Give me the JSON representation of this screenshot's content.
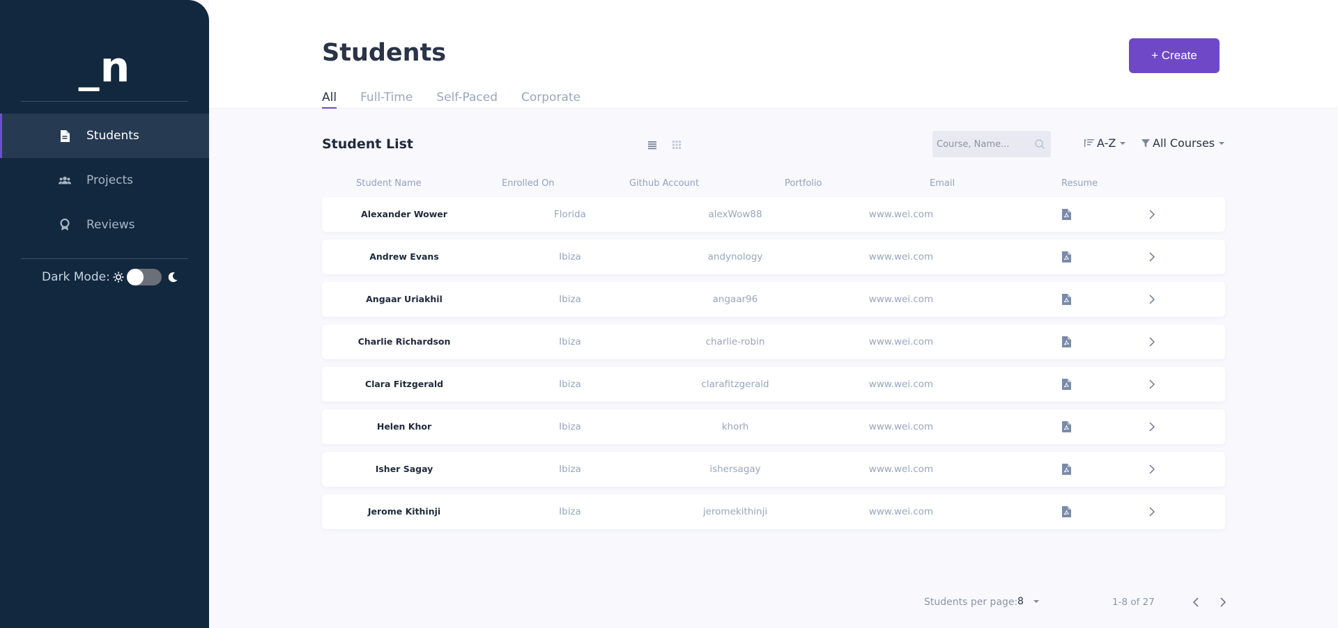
{
  "app": {
    "logo": "_n"
  },
  "sidebar": {
    "items": [
      {
        "label": "Students",
        "icon": "document-icon",
        "active": true
      },
      {
        "label": "Projects",
        "icon": "users-icon",
        "active": false
      },
      {
        "label": "Reviews",
        "icon": "award-icon",
        "active": false
      }
    ],
    "dark_mode": {
      "label": "Dark Mode:",
      "enabled": false
    }
  },
  "header": {
    "title": "Students",
    "create_label": "+ Create",
    "tabs": [
      {
        "label": "All",
        "active": true
      },
      {
        "label": "Full-Time",
        "active": false
      },
      {
        "label": "Self-Paced",
        "active": false
      },
      {
        "label": "Corporate",
        "active": false
      }
    ]
  },
  "toolbar": {
    "list_title": "Student List",
    "search_placeholder": "Course, Name...",
    "sort_label": "A-Z",
    "filter_label": "All Courses"
  },
  "table": {
    "columns": [
      "Student Name",
      "Enrolled On",
      "Github Account",
      "Portfolio",
      "Email",
      "Resume"
    ],
    "rows": [
      {
        "name": "Alexander Wower",
        "enrolled": "Florida",
        "github": "alexWow88",
        "portfolio": "www.wei.com"
      },
      {
        "name": "Andrew Evans",
        "enrolled": "Ibiza",
        "github": "andynology",
        "portfolio": "www.wei.com"
      },
      {
        "name": "Angaar Uriakhil",
        "enrolled": "Ibiza",
        "github": "angaar96",
        "portfolio": "www.wei.com"
      },
      {
        "name": "Charlie Richardson",
        "enrolled": "Ibiza",
        "github": "charlie-robin",
        "portfolio": "www.wei.com"
      },
      {
        "name": "Clara Fitzgerald",
        "enrolled": "Ibiza",
        "github": "clarafitzgerald",
        "portfolio": "www.wei.com"
      },
      {
        "name": "Helen Khor",
        "enrolled": "Ibiza",
        "github": "khorh",
        "portfolio": "www.wei.com"
      },
      {
        "name": "Isher Sagay",
        "enrolled": "Ibiza",
        "github": "ishersagay",
        "portfolio": "www.wei.com"
      },
      {
        "name": "Jerome Kithinji",
        "enrolled": "Ibiza",
        "github": "jeromekithinji",
        "portfolio": "www.wei.com"
      }
    ]
  },
  "pagination": {
    "per_page_label": "Students per page:",
    "per_page_value": "8",
    "range_label": "1-8 of 27"
  },
  "colors": {
    "sidebar_bg": "#12283f",
    "accent": "#6e48c7",
    "page_bg": "#f8f8fd"
  }
}
